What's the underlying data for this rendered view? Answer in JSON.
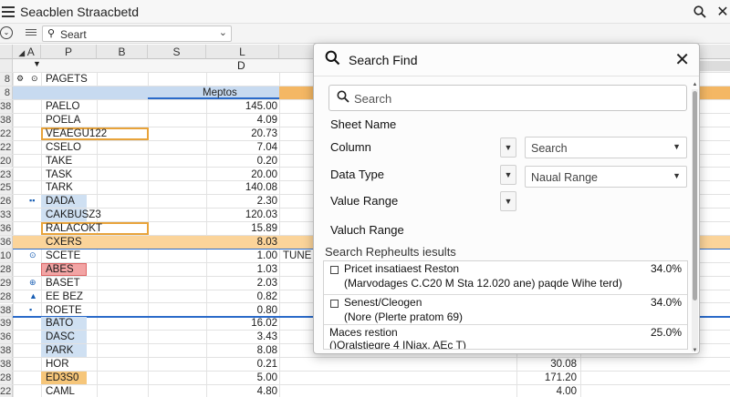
{
  "window": {
    "title": "Seacblen Straacbetd"
  },
  "toolbar": {
    "search_value": "Seart"
  },
  "columns": [
    "A",
    "P",
    "B",
    "S",
    "L"
  ],
  "header_rows": {
    "d_label": "D",
    "col_a_header": "PAGETS",
    "section_label": "Meptos"
  },
  "rows": [
    {
      "num": "38",
      "name": "PAELO",
      "value": "145.00",
      "extra": ""
    },
    {
      "num": "38",
      "name": "POELA",
      "value": "4.09",
      "extra": ""
    },
    {
      "num": "22",
      "name": "VEAEGU122",
      "value": "20.73",
      "extra": ""
    },
    {
      "num": "22",
      "name": "CSELO",
      "value": "7.04",
      "extra": ""
    },
    {
      "num": "20",
      "name": "TAKE",
      "value": "0.20",
      "extra": ""
    },
    {
      "num": "23",
      "name": "TASK",
      "value": "20.00",
      "extra": ""
    },
    {
      "num": "25",
      "name": "TARK",
      "value": "140.08",
      "extra": ""
    },
    {
      "num": "26",
      "name": "DADA",
      "value": "2.30",
      "extra": ""
    },
    {
      "num": "33",
      "name": "CAKBUSZ3",
      "value": "120.03",
      "extra": ""
    },
    {
      "num": "36",
      "name": "RALACOKT",
      "value": "15.89",
      "extra": ""
    },
    {
      "num": "36",
      "name": "CXERS",
      "value": "8.03",
      "extra": ""
    },
    {
      "num": "10",
      "name": "SCETE",
      "value": "1.00",
      "extra": "TUNE"
    },
    {
      "num": "28",
      "name": "ABES",
      "value": "1.03",
      "extra": ""
    },
    {
      "num": "29",
      "name": "BASET",
      "value": "2.03",
      "extra": ""
    },
    {
      "num": "28",
      "name": "EE BEZ",
      "value": "0.82",
      "extra": ""
    },
    {
      "num": "38",
      "name": "ROETE",
      "value": "0.80",
      "extra": ""
    },
    {
      "num": "39",
      "name": "BATO",
      "value": "16.02",
      "extra": ""
    },
    {
      "num": "36",
      "name": "DASC",
      "value": "3.43",
      "extra": ""
    },
    {
      "num": "38",
      "name": "PARK",
      "value": "8.08",
      "extra": ""
    },
    {
      "num": "38",
      "name": "HOR",
      "value": "0.21",
      "extra": "30.08"
    },
    {
      "num": "28",
      "name": "ED3S0",
      "value": "5.00",
      "extra": "171.20"
    },
    {
      "num": "22",
      "name": "CAML",
      "value": "4.80",
      "extra": "4.00"
    }
  ],
  "dialog": {
    "title": "Search Find",
    "search_placeholder": "Search",
    "sheet_name_label": "Sheet Name",
    "column_label": "Column",
    "column_value": "Search",
    "data_type_label": "Data Type",
    "data_type_value": "Naual Range",
    "value_range_label": "Value Range",
    "valuch_range_label": "Valuch Range",
    "results_header": "Search Repheults iesults",
    "results": [
      {
        "line1": "Pricet insatiaest Reston",
        "line2": "(Marvodages C.C20 M Sta 12.020 ane) paqde Wihe terd)",
        "percent": "34.0%"
      },
      {
        "line1": "Senest/Cleogen",
        "line2": "(Nore (Plerte pratom 69)",
        "percent": "34.0%"
      },
      {
        "line1": "Maces restion",
        "line2": "()Oralstiegre 4 INiax, AEc T)",
        "percent": "25.0%"
      }
    ]
  }
}
